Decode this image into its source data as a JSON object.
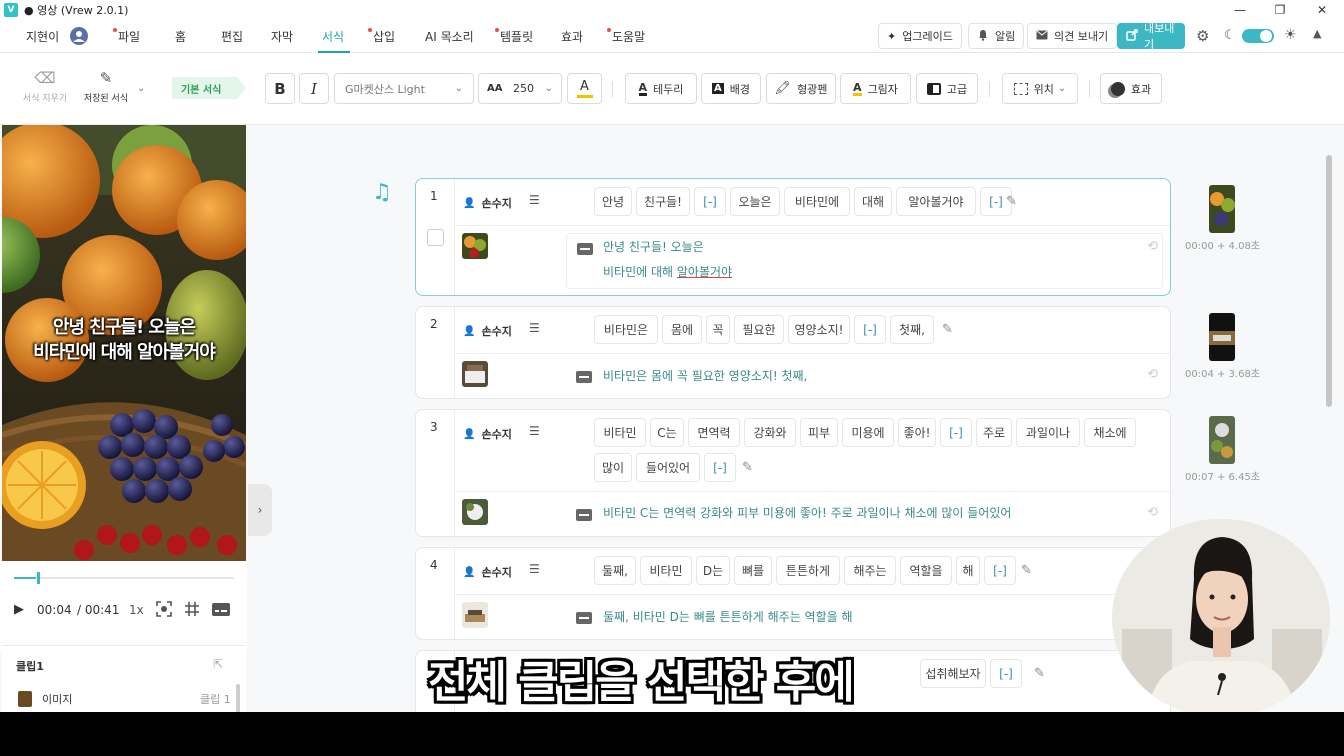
{
  "window": {
    "title": "● 영상 (Vrew 2.0.1)",
    "logo": "V",
    "controls": [
      "—",
      "❐",
      "✕"
    ]
  },
  "menu": {
    "user": "지현이",
    "items": [
      "파일",
      "홈",
      "편집",
      "자막",
      "서식",
      "삽입",
      "AI 목소리",
      "템플릿",
      "효과",
      "도움말"
    ],
    "active": "서식",
    "right": {
      "upgrade": "업그레이드",
      "alerts": "알림",
      "feedback": "의견 보내기",
      "export": "내보내기"
    }
  },
  "toolbar": {
    "clear_format": "서식 지우기",
    "saved_format": "저장된 서식",
    "preset": "기본 서식",
    "bold": "B",
    "italic": "I",
    "font": "G마켓산스 Light",
    "size_icon": "AA",
    "size": "250",
    "color_glyph": "A",
    "border": "테두리",
    "background": "배경",
    "highlighter": "형광펜",
    "shadow": "그림자",
    "advanced": "고급",
    "position": "위치",
    "effects": "효과",
    "colors": {
      "accent": "#1aa6a6",
      "export": "#3bb8c4",
      "text_color_underline": "#f2c200"
    }
  },
  "video": {
    "caption_line1": "안녕 친구들! 오늘은",
    "caption_line2": "비타민에 대해 알아볼거야"
  },
  "player": {
    "current": "00:04",
    "total": "/ 00:41",
    "speed": "1x",
    "progress": 0.1
  },
  "clips_panel": {
    "title": "클립1",
    "row_label": "이미지",
    "row_value": "클립 1"
  },
  "clips": [
    {
      "num": "1",
      "speaker": "손수지",
      "words": [
        "안녕",
        "친구들!",
        "[-]",
        "오늘은",
        "비타민에",
        "대해",
        "알아볼거야",
        "[-]"
      ],
      "subtitle_line1": "안녕 친구들! 오늘은",
      "subtitle_line2_a": "비타민에 대해",
      "subtitle_line2_b": "알아볼거야",
      "time": "00:00 + 4.08초"
    },
    {
      "num": "2",
      "speaker": "손수지",
      "words": [
        "비타민은",
        "몸에",
        "꼭",
        "필요한",
        "영양소지!",
        "[-]",
        "첫째,"
      ],
      "subtitle": "비타민은 몸에 꼭 필요한 영양소지! 첫째,",
      "time": "00:04 + 3.68초"
    },
    {
      "num": "3",
      "speaker": "손수지",
      "words": [
        "비타민",
        "C는",
        "면역력",
        "강화와",
        "피부",
        "미용에",
        "좋아!",
        "[-]",
        "주로",
        "과일이나",
        "채소에"
      ],
      "words_row2": [
        "많이",
        "들어있어",
        "[-]"
      ],
      "subtitle": "비타민 C는 면역력 강화와 피부 미용에 좋아! 주로 과일이나 채소에 많이 들어있어",
      "time": "00:07 + 6.45초"
    },
    {
      "num": "4",
      "speaker": "손수지",
      "words": [
        "둘째,",
        "비타민",
        "D는",
        "뼈를",
        "튼튼하게",
        "해주는",
        "역할을",
        "해",
        "[-]"
      ],
      "subtitle": "둘째, 비타민 D는 뼈를 튼튼하게 해주는 역할을 해"
    },
    {
      "partial_words": [
        "섭취해보자",
        "[-]"
      ]
    }
  ],
  "overlay_subtitle": "전체 클립을 선택한 후에"
}
